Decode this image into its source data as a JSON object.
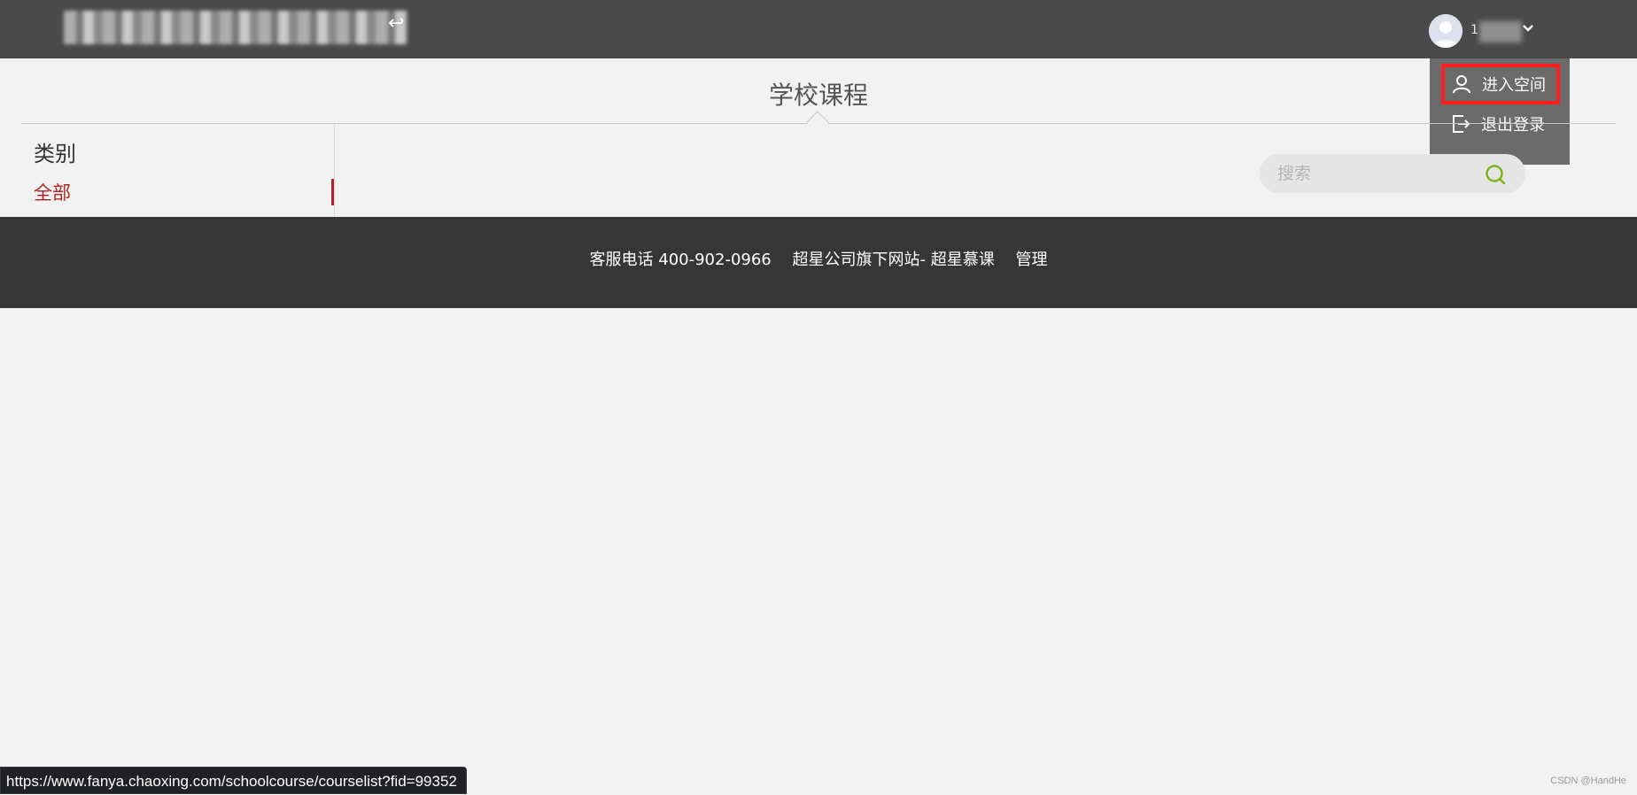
{
  "header": {
    "user_name_visible": "1",
    "dropdown_icon": "chevron-down-icon"
  },
  "user_menu": {
    "items": [
      {
        "label": "进入空间",
        "icon": "user-icon",
        "highlighted": true
      },
      {
        "label": "退出登录",
        "icon": "logout-icon",
        "highlighted": false
      }
    ]
  },
  "page": {
    "title": "学校课程"
  },
  "sidebar": {
    "heading": "类别",
    "items": [
      {
        "label": "全部",
        "active": true
      }
    ]
  },
  "search": {
    "placeholder": "搜索"
  },
  "footer": {
    "hotline": "客服电话 400-902-0966",
    "site_link": "超星公司旗下网站- 超星慕课",
    "admin_link": "管理"
  },
  "status_bar": {
    "url": "https://www.fanya.chaoxing.com/schoolcourse/courselist?fid=99352"
  },
  "watermark": "CSDN @HandHe",
  "colors": {
    "header_bg": "#4a4a4a",
    "menu_bg": "#6b6b6b",
    "highlight_border": "#ff1e1e",
    "active_category": "#b22222",
    "search_icon": "#7cb518",
    "footer_bg": "#363636"
  }
}
